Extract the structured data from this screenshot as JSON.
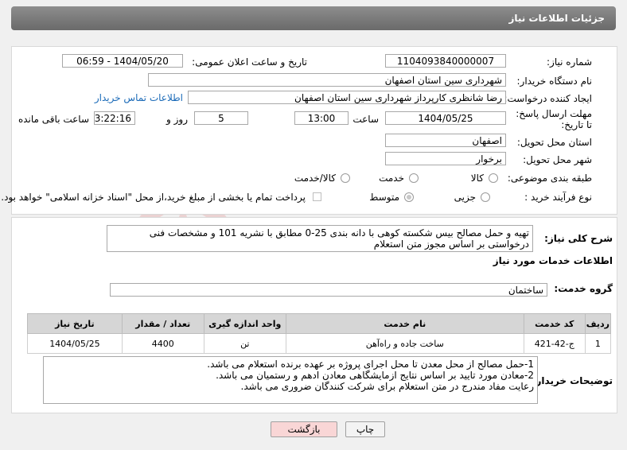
{
  "header": {
    "title": "جزئیات اطلاعات نیاز"
  },
  "fields": {
    "need_number_label": "شماره نیاز:",
    "need_number": "1104093840000007",
    "announce_label": "تاریخ و ساعت اعلان عمومی:",
    "announce_value": "1404/05/20 - 06:59",
    "buyer_org_label": "نام دستگاه خریدار:",
    "buyer_org": "شهرداری سین استان اصفهان",
    "creator_label": "ایجاد کننده درخواست:",
    "creator": "رضا شانظری کارپرداز شهرداری سین استان اصفهان",
    "contact_link": "اطلاعات تماس خریدار",
    "deadline_label": "مهلت ارسال پاسخ: تا تاریخ:",
    "deadline_date": "1404/05/25",
    "time_label": "ساعت",
    "deadline_time": "13:00",
    "days": "5",
    "days_label": "روز و",
    "remaining_time": "03:22:16",
    "remaining_label": "ساعت باقی مانده",
    "province_label": "استان محل تحویل:",
    "province": "اصفهان",
    "city_label": "شهر محل تحویل:",
    "city": "برخوار",
    "category_label": "طبقه بندی موضوعی:",
    "category_options": [
      "کالا",
      "خدمت",
      "کالا/خدمت"
    ],
    "process_label": "نوع فرآیند خرید :",
    "process_options": [
      "جزیی",
      "متوسط"
    ],
    "payment_note": "پرداخت تمام یا بخشی از مبلغ خرید،از محل \"اسناد خزانه اسلامی\" خواهد بود."
  },
  "description": {
    "label": "شرح کلی نیاز:",
    "text": "تهیه و حمل مصالح بیس شکسته کوهی با دانه بندی 25-0 مطابق با نشریه 101 و مشخصات فنی درخواستی بر اساس مجوز متن استعلام"
  },
  "services": {
    "section_title": "اطلاعات خدمات مورد نیاز",
    "group_label": "گروه خدمت:",
    "group_value": "ساختمان",
    "columns": [
      "ردیف",
      "کد خدمت",
      "نام خدمت",
      "واحد اندازه گیری",
      "تعداد / مقدار",
      "تاریخ نیاز"
    ],
    "rows": [
      [
        "1",
        "ج-42-421",
        "ساخت جاده و راه‌آهن",
        "تن",
        "4400",
        "1404/05/25"
      ]
    ]
  },
  "buyer_notes": {
    "label": "توضیحات خریدار:",
    "lines": [
      "1-حمل مصالح از محل معدن تا محل اجرای پروژه بر عهده برنده استعلام می باشد.",
      "2-معادن مورد تایید بر اساس نتایج ازمایشگاهی معادن ادهم و رستمیان می باشد.",
      "رعایت مفاد مندرج در متن استعلام برای شرکت کنندگان ضروری می باشد."
    ]
  },
  "buttons": {
    "print": "چاپ",
    "back": "بازگشت"
  },
  "colors": {
    "link": "#1a6ab8",
    "back_button_bg": "#f9d6d6"
  }
}
